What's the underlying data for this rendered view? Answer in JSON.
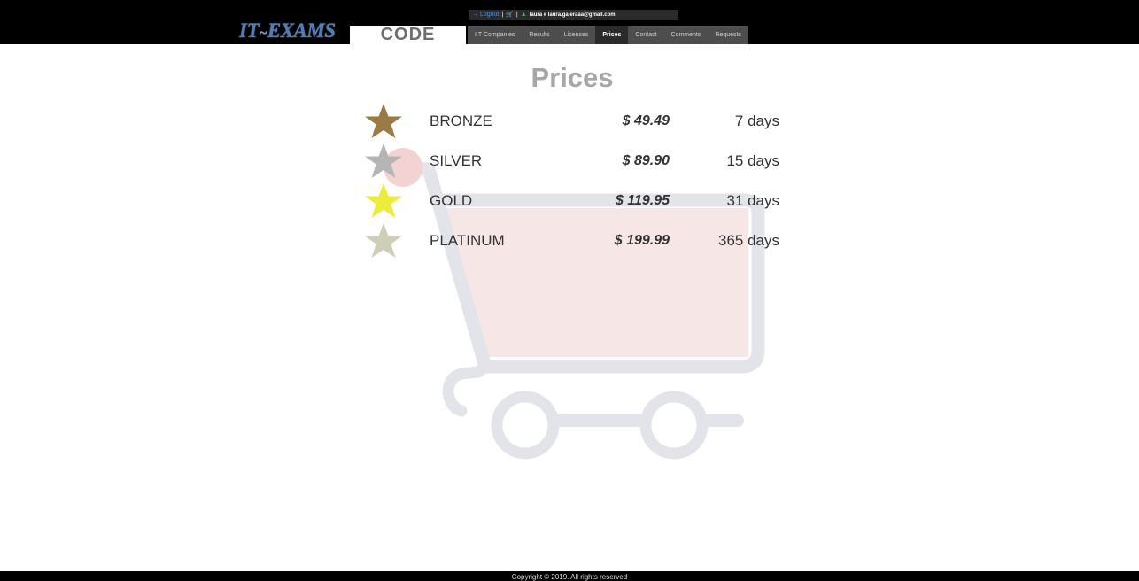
{
  "header": {
    "topbar": {
      "logout_label": "Logout",
      "user_label": "laura # laura.galeraaa@gmail.com"
    },
    "logo": {
      "left": "IT",
      "sep": "~",
      "right": "EXAMS"
    },
    "code_label": "CODE",
    "nav": [
      {
        "label": "I.T Companies",
        "active": false
      },
      {
        "label": "Results",
        "active": false
      },
      {
        "label": "Licenses",
        "active": false
      },
      {
        "label": "Prices",
        "active": true
      },
      {
        "label": "Contact",
        "active": false
      },
      {
        "label": "Comments",
        "active": false
      },
      {
        "label": "Requests",
        "active": false
      }
    ]
  },
  "main": {
    "title": "Prices",
    "tiers": [
      {
        "name": "BRONZE",
        "price": "$ 49.49",
        "duration": "7 days",
        "star_color": "#9b7a45"
      },
      {
        "name": "SILVER",
        "price": "$ 89.90",
        "duration": "15 days",
        "star_color": "#b5b5b5"
      },
      {
        "name": "GOLD",
        "price": "$ 119.95",
        "duration": "31 days",
        "star_color": "#ecec3c"
      },
      {
        "name": "PLATINUM",
        "price": "$ 199.99",
        "duration": "365 days",
        "star_color": "#cfcfb8"
      }
    ]
  },
  "footer": {
    "copyright": "Copyright © 2019. All rights reserved"
  },
  "colors": {
    "header_bg": "#000000",
    "nav_bg": "#4d4d4d",
    "nav_active_bg": "#2a2a2a",
    "logo": "#4f7cb8",
    "title": "#a7a7a7",
    "cart_outline": "#e3e4ea",
    "cart_fill": "#f7e6e6",
    "cart_dot": "#f3d2d2"
  },
  "icons": {
    "logout": "logout-icon",
    "cart": "cart-icon",
    "user": "user-icon",
    "star": "star-icon",
    "background": "shopping-cart-illustration"
  }
}
